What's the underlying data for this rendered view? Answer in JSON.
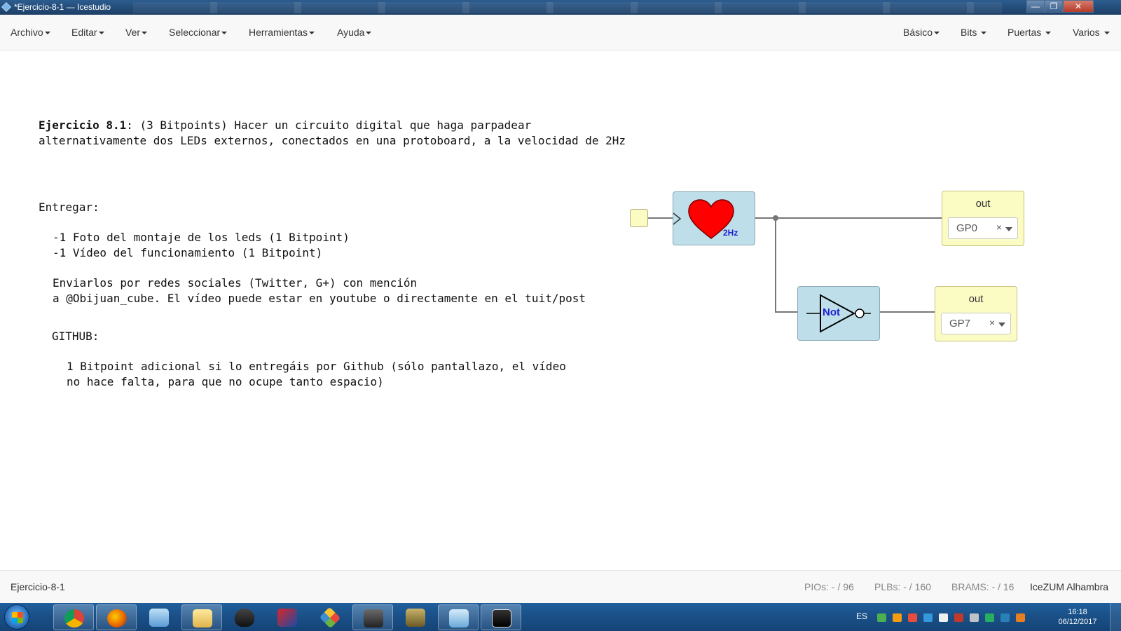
{
  "window": {
    "title": "*Ejercicio-8-1 — Icestudio",
    "controls": {
      "minimize": "—",
      "maximize": "❐",
      "close": "✕"
    }
  },
  "menubar": {
    "left": [
      "Archivo",
      "Editar",
      "Ver",
      "Seleccionar",
      "Herramientas",
      "Ayuda"
    ],
    "right": [
      "Básico",
      "Bits",
      "Puertas",
      "Varios"
    ]
  },
  "note": {
    "heading_bold": "Ejercicio 8.1",
    "line1_rest": ": (3 Bitpoints) Hacer un circuito digital que haga parpadear",
    "line2": "alternativamente dos LEDs externos, conectados en una protoboard, a la velocidad de 2Hz",
    "deliver_title": "Entregar:",
    "deliver_item1": "-1 Foto del montaje de los leds (1 Bitpoint)",
    "deliver_item2": "-1 Vídeo del funcionamiento (1 Bitpoint)",
    "send_line1": "Enviarlos por redes sociales (Twitter, G+) con mención",
    "send_line2": "a @Obijuan_cube. El vídeo puede estar en youtube o directamente en el tuit/post",
    "github_title": "GITHUB:",
    "github_line1": "1 Bitpoint adicional si lo entregáis por Github (sólo pantallazo, el vídeo",
    "github_line2": "no hace falta, para que no ocupe tanto espacio)"
  },
  "circuit": {
    "heart_block": {
      "freq_label": "2Hz",
      "icon": "heart-icon",
      "color": "#ff0000"
    },
    "not_block": {
      "label": "Not",
      "icon": "not-gate-icon",
      "label_color": "#1f1fd1"
    },
    "outputs": [
      {
        "label": "out",
        "pin": "GP0",
        "clear": "×"
      },
      {
        "label": "out",
        "pin": "GP7",
        "clear": "×"
      }
    ],
    "colors": {
      "block_fill": "#bedfea",
      "io_fill": "#fbfbc4",
      "wire": "#777777"
    }
  },
  "statusbar": {
    "project": "Ejercicio-8-1",
    "pios": "PIOs:  - / 96",
    "plbs": "PLBs:  - / 160",
    "brams": "BRAMS:  - / 16",
    "board": "IceZUM Alhambra"
  },
  "taskbar": {
    "apps": [
      "chrome-icon",
      "firefox-icon",
      "control-panel-icon",
      "file-explorer-icon",
      "inkscape-icon",
      "freecad-icon",
      "git-icon",
      "audio-app-icon",
      "fritzing-icon",
      "icestudio-icon",
      "terminal-icon"
    ],
    "language": "ES",
    "time": "16:18",
    "date": "06/12/2017"
  }
}
